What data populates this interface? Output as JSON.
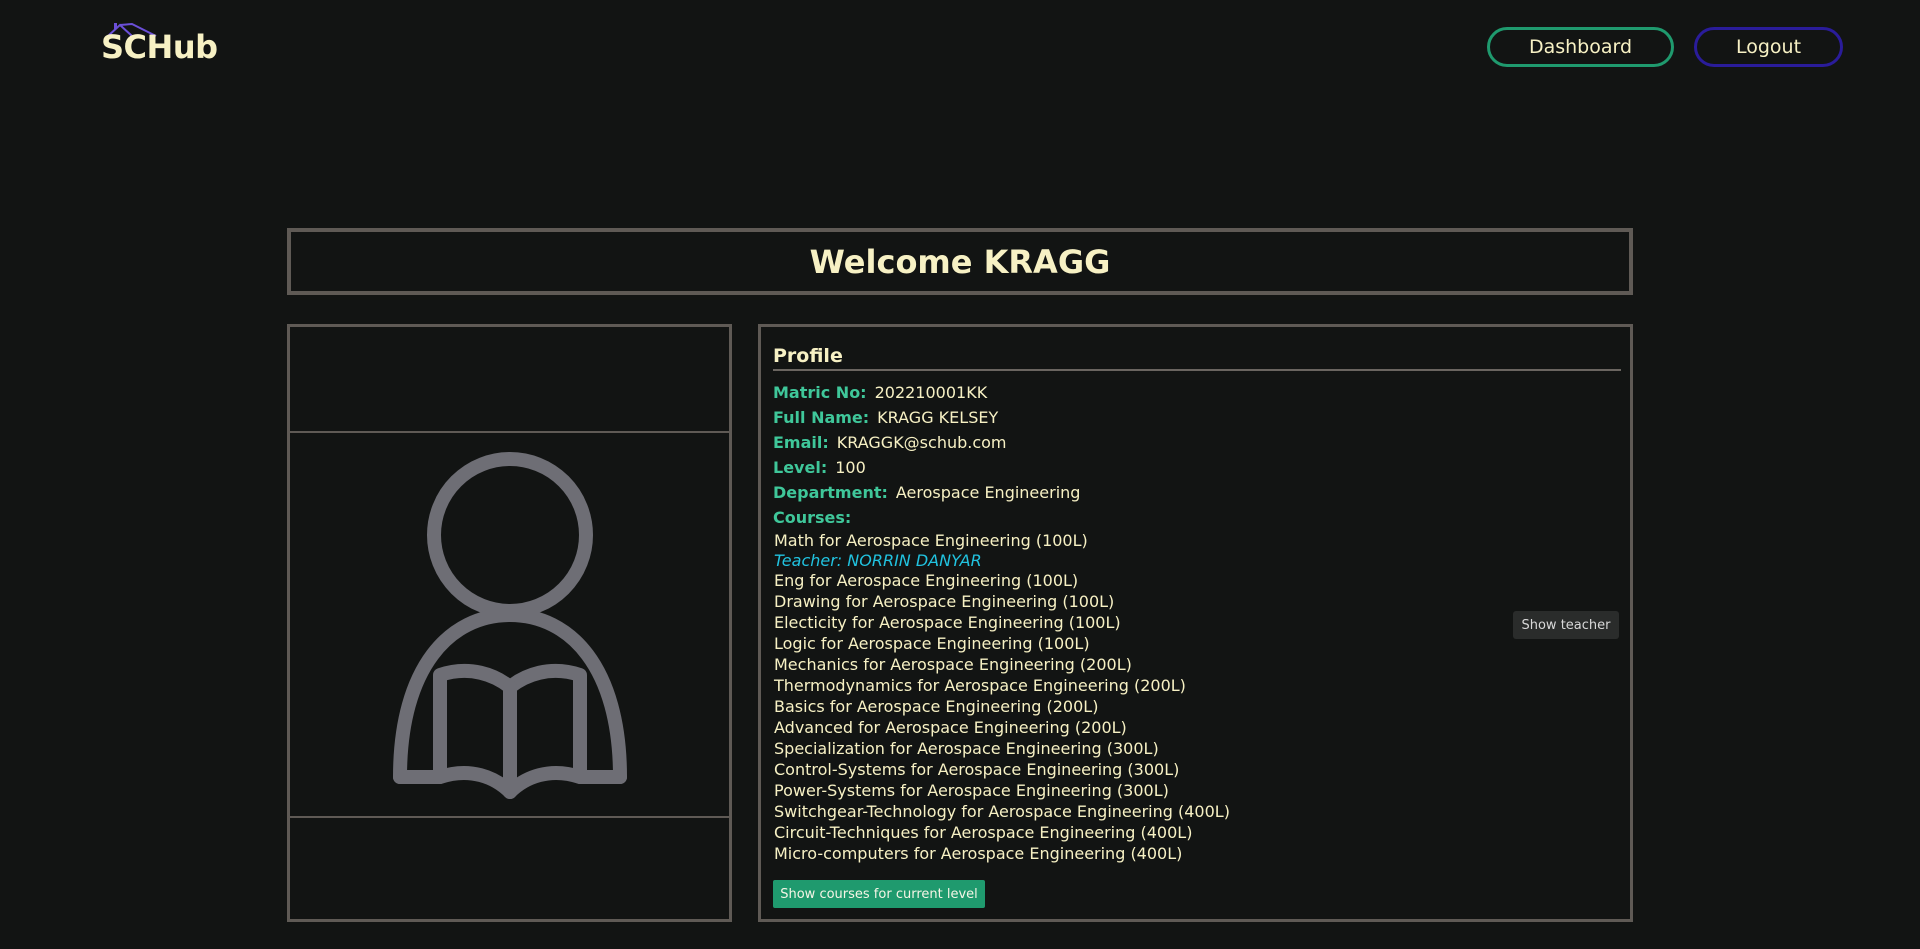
{
  "header": {
    "logo_text": "SCHub",
    "logo_icon": "house-roof-icon",
    "dashboard_label": "Dashboard",
    "logout_label": "Logout"
  },
  "welcome": {
    "title": "Welcome KRAGG"
  },
  "avatar": {
    "icon": "student-reading-icon"
  },
  "profile": {
    "heading": "Profile",
    "fields": [
      {
        "label": "Matric No:",
        "value": "202210001KK"
      },
      {
        "label": "Full Name:",
        "value": "KRAGG KELSEY"
      },
      {
        "label": "Email:",
        "value": "KRAGGK@schub.com"
      },
      {
        "label": "Level:",
        "value": "100"
      },
      {
        "label": "Department:",
        "value": "Aerospace Engineering"
      }
    ],
    "courses_label": "Courses:",
    "first_course": "Math for Aerospace Engineering (100L)",
    "teacher_text": "Teacher: NORRIN DANYAR",
    "courses": [
      "Eng for Aerospace Engineering (100L)",
      "Drawing for Aerospace Engineering (100L)",
      "Electicity for Aerospace Engineering (100L)",
      "Logic for Aerospace Engineering (100L)",
      "Mechanics for Aerospace Engineering (200L)",
      "Thermodynamics for Aerospace Engineering (200L)",
      "Basics for Aerospace Engineering (200L)",
      "Advanced for Aerospace Engineering (200L)",
      "Specialization for Aerospace Engineering (300L)",
      "Control-Systems for Aerospace Engineering (300L)",
      "Power-Systems for Aerospace Engineering (300L)",
      "Switchgear-Technology for Aerospace Engineering (400L)",
      "Circuit-Techniques for Aerospace Engineering (400L)",
      "Micro-computers for Aerospace Engineering (400L)"
    ],
    "show_teacher_label": "Show teacher",
    "show_current_label": "Show courses for current level"
  },
  "colors": {
    "background": "#121413",
    "text": "#f7f1c4",
    "label_green": "#3fc79a",
    "teacher_cyan": "#21c3e0",
    "dashboard_border": "#1f9a6e",
    "logout_border": "#2a1c9a",
    "card_border": "#5f5a55",
    "icon_gray": "#6e6e75"
  }
}
